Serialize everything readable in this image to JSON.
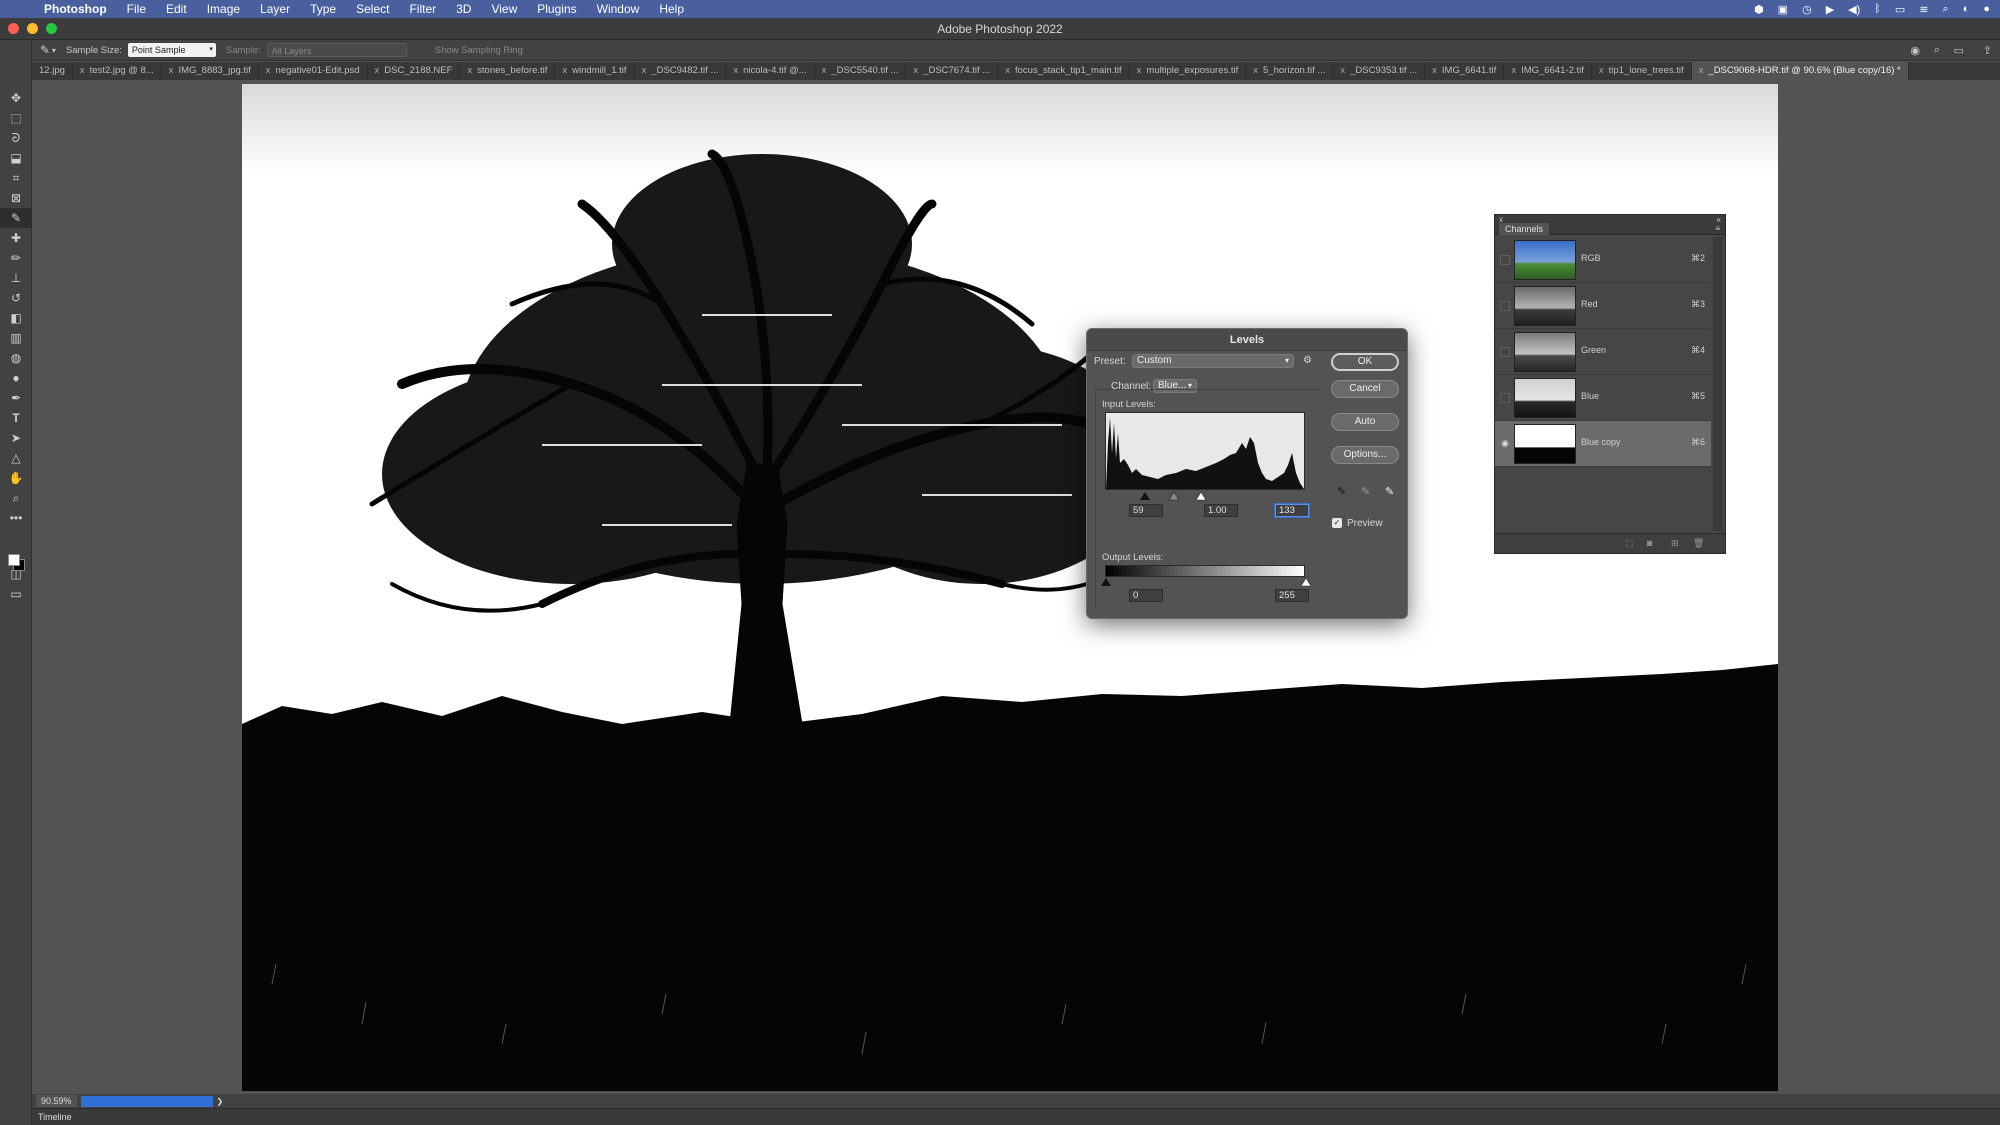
{
  "menubar": {
    "app_name": "Photoshop",
    "items": [
      "File",
      "Edit",
      "Image",
      "Layer",
      "Type",
      "Select",
      "Filter",
      "3D",
      "View",
      "Plugins",
      "Window",
      "Help"
    ]
  },
  "window": {
    "title": "Adobe Photoshop 2022"
  },
  "options_bar": {
    "sample_size_label": "Sample Size:",
    "sample_size_value": "Point Sample",
    "sample_label": "Sample:",
    "sample_value": "All Layers",
    "show_ring_label": "Show Sampling Ring"
  },
  "tabs": [
    "12.jpg",
    "test2.jpg @ 8...",
    "IMG_8883_jpg.tif",
    "negative01-Edit.psd",
    "DSC_2188.NEF",
    "stones_before.tif",
    "windmill_1.tif",
    "_DSC9482.tif ...",
    "nicola-4.tif @...",
    "_DSC5540.tif ...",
    "_DSC7674.tif ...",
    "focus_stack_tip1_main.tif",
    "multiple_exposures.tif",
    "5_horizon.tif ...",
    "_DSC9353.tif ...",
    "IMG_6641.tif",
    "IMG_6641-2.tif",
    "tip1_lone_trees.tif",
    "_DSC9068-HDR.tif @ 90.6% (Blue copy/16) *"
  ],
  "status": {
    "zoom": "90.59%",
    "timeline": "Timeline"
  },
  "levels": {
    "title": "Levels",
    "preset_label": "Preset:",
    "preset_value": "Custom",
    "channel_label": "Channel:",
    "channel_value": "Blue...",
    "input_levels_label": "Input Levels:",
    "input_black": "59",
    "input_gamma": "1.00",
    "input_white": "133",
    "output_levels_label": "Output Levels:",
    "output_black": "0",
    "output_white": "255",
    "buttons": {
      "ok": "OK",
      "cancel": "Cancel",
      "auto": "Auto",
      "options": "Options..."
    },
    "preview_label": "Preview"
  },
  "channels_panel": {
    "title": "Channels",
    "rows": [
      {
        "name": "RGB",
        "shortcut": "⌘2"
      },
      {
        "name": "Red",
        "shortcut": "⌘3"
      },
      {
        "name": "Green",
        "shortcut": "⌘4"
      },
      {
        "name": "Blue",
        "shortcut": "⌘5"
      },
      {
        "name": "Blue copy",
        "shortcut": "⌘6"
      }
    ]
  },
  "colors": {
    "menubar": "#4a5f9e",
    "accent": "#2f6fd6",
    "panel": "#535353"
  }
}
